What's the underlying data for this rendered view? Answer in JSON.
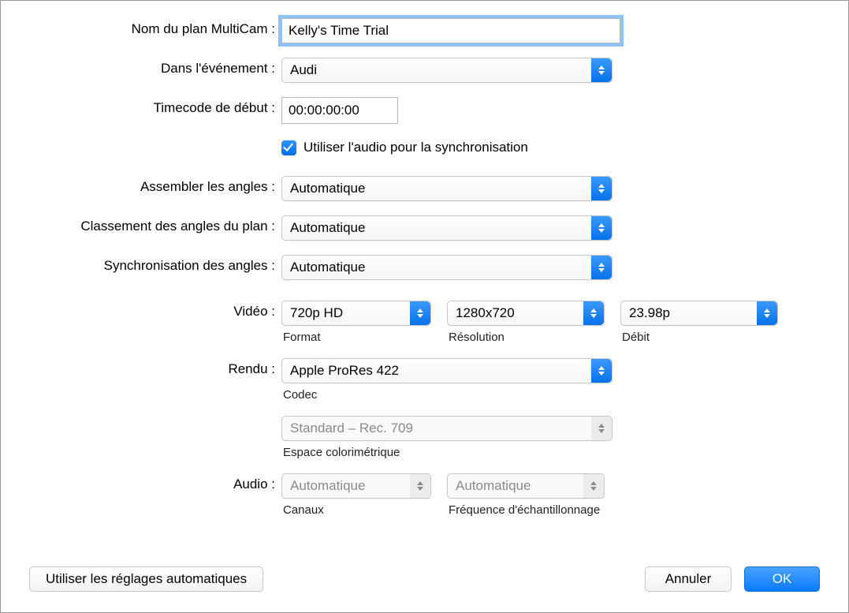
{
  "labels": {
    "name": "Nom du plan MultiCam :",
    "event": "Dans l'événement :",
    "start_tc": "Timecode de début :",
    "assemble": "Assembler les angles :",
    "ordering": "Classement des angles du plan :",
    "sync": "Synchronisation des angles :",
    "video": "Vidéo :",
    "render": "Rendu :",
    "audio": "Audio :"
  },
  "sublabels": {
    "format": "Format",
    "resolution": "Résolution",
    "rate": "Débit",
    "codec": "Codec",
    "colorspace": "Espace colorimétrique",
    "channels": "Canaux",
    "samplerate": "Fréquence d'échantillonnage"
  },
  "values": {
    "name": "Kelly's Time Trial",
    "event": "Audi",
    "start_tc": "00:00:00:00",
    "use_audio_sync_label": "Utiliser l'audio pour la synchronisation",
    "use_audio_sync_checked": true,
    "assemble": "Automatique",
    "ordering": "Automatique",
    "sync": "Automatique",
    "video_format": "720p HD",
    "video_resolution": "1280x720",
    "video_rate": "23.98p",
    "render_codec": "Apple ProRes 422",
    "colorspace": "Standard – Rec. 709",
    "audio_channels": "Automatique",
    "audio_samplerate": "Automatique"
  },
  "buttons": {
    "auto": "Utiliser les réglages automatiques",
    "cancel": "Annuler",
    "ok": "OK"
  }
}
